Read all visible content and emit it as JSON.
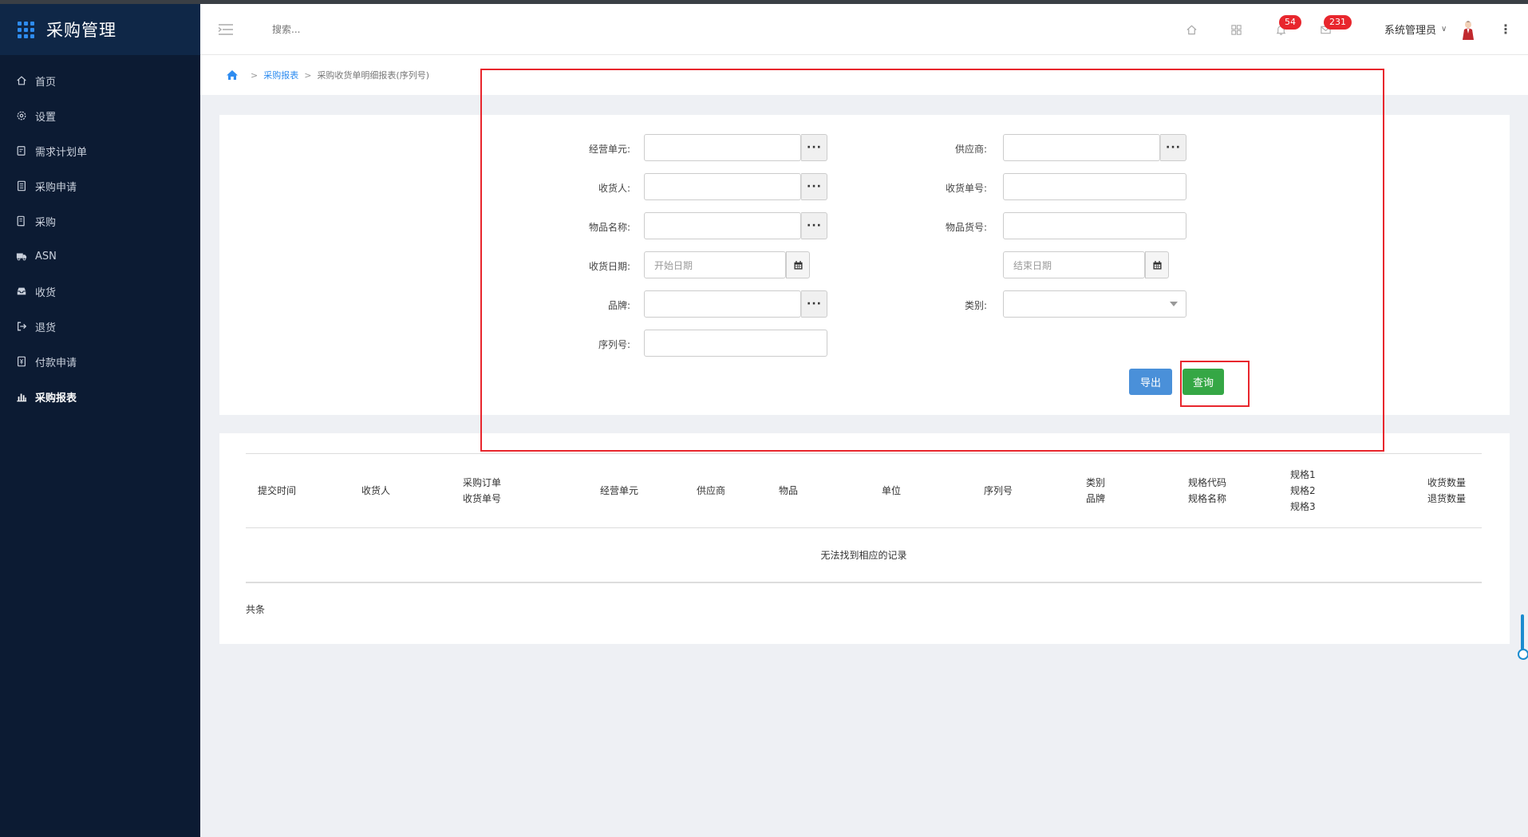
{
  "app": {
    "title": "采购管理"
  },
  "sidebar": {
    "items": [
      {
        "label": "首页",
        "icon": "home-icon"
      },
      {
        "label": "设置",
        "icon": "gear-icon"
      },
      {
        "label": "需求计划单",
        "icon": "document-edit-icon"
      },
      {
        "label": "采购申请",
        "icon": "form-icon"
      },
      {
        "label": "采购",
        "icon": "list-doc-icon"
      },
      {
        "label": "ASN",
        "icon": "truck-icon"
      },
      {
        "label": "收货",
        "icon": "inbox-icon"
      },
      {
        "label": "退货",
        "icon": "sign-out-icon"
      },
      {
        "label": "付款申请",
        "icon": "payment-icon"
      },
      {
        "label": "采购报表",
        "icon": "bar-chart-icon"
      }
    ],
    "active_index": 9
  },
  "header": {
    "search_placeholder": "搜索...",
    "notifications_count": "54",
    "messages_count": "231",
    "user_name": "系统管理员"
  },
  "breadcrumb": {
    "parent": "采购报表",
    "current": "采购收货单明细报表(序列号)"
  },
  "form": {
    "operating_unit_label": "经营单元:",
    "supplier_label": "供应商:",
    "receiver_label": "收货人:",
    "receipt_no_label": "收货单号:",
    "item_name_label": "物品名称:",
    "item_code_label": "物品货号:",
    "receipt_date_label": "收货日期:",
    "start_date_placeholder": "开始日期",
    "end_date_placeholder": "结束日期",
    "brand_label": "品牌:",
    "category_label": "类别:",
    "serial_no_label": "序列号:",
    "export_button": "导出",
    "query_button": "查询"
  },
  "table": {
    "columns": [
      {
        "line1": "提交时间",
        "line2": "",
        "line3": ""
      },
      {
        "line1": "收货人",
        "line2": "",
        "line3": ""
      },
      {
        "line1": "采购订单",
        "line2": "收货单号",
        "line3": ""
      },
      {
        "line1": "经营单元",
        "line2": "",
        "line3": ""
      },
      {
        "line1": "供应商",
        "line2": "",
        "line3": ""
      },
      {
        "line1": "物品",
        "line2": "",
        "line3": ""
      },
      {
        "line1": "单位",
        "line2": "",
        "line3": ""
      },
      {
        "line1": "序列号",
        "line2": "",
        "line3": ""
      },
      {
        "line1": "类别",
        "line2": "品牌",
        "line3": ""
      },
      {
        "line1": "规格代码",
        "line2": "规格名称",
        "line3": ""
      },
      {
        "line1": "规格1",
        "line2": "规格2",
        "line3": "规格3"
      },
      {
        "line1": "收货数量",
        "line2": "退货数量",
        "line3": ""
      }
    ],
    "empty_message": "无法找到相应的记录",
    "total_text": "共条"
  }
}
